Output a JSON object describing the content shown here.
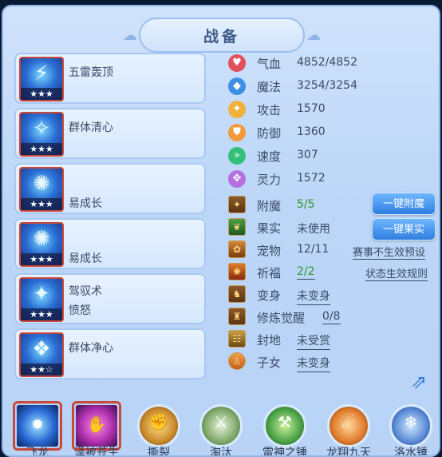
{
  "header": {
    "title": "战备"
  },
  "skills": [
    {
      "name": "五雷轰顶",
      "stars": "★★★",
      "glyph": "⚡"
    },
    {
      "name": "群体清心",
      "stars": "★★★",
      "glyph": "✧"
    },
    {
      "name": "易成长",
      "stars": "★★★",
      "glyph": "✺"
    },
    {
      "name": "易成长",
      "stars": "★★★",
      "glyph": "✺"
    },
    {
      "name": "驾驭术",
      "sub": "愤怒",
      "stars": "★★★",
      "glyph": "✦"
    },
    {
      "name": "群体净心",
      "stars": "★★☆",
      "glyph": "❖"
    }
  ],
  "stats": [
    {
      "label": "气血",
      "value": "4852/4852",
      "color": "#e2505a",
      "glyph": "♥"
    },
    {
      "label": "魔法",
      "value": "3254/3254",
      "color": "#3f8fe8",
      "glyph": "◆"
    },
    {
      "label": "攻击",
      "value": "1570",
      "color": "#f0b23a",
      "glyph": "✦"
    },
    {
      "label": "防御",
      "value": "1360",
      "color": "#f09a3a",
      "glyph": "⛊"
    },
    {
      "label": "速度",
      "value": "307",
      "color": "#33c07a",
      "glyph": "»"
    },
    {
      "label": "灵力",
      "value": "1572",
      "color": "#b56fe0",
      "glyph": "✥"
    }
  ],
  "info": {
    "fumo": {
      "label": "附魔",
      "value": "5/5"
    },
    "guoshi": {
      "label": "果实",
      "value": "未使用"
    },
    "chongwu": {
      "label": "宠物",
      "value": "12/11"
    },
    "qifu": {
      "label": "祈福",
      "value": "2/2"
    },
    "bianshen": {
      "label": "变身",
      "value": "未变身"
    },
    "xiulian": {
      "label": "修炼觉醒",
      "value": "0/8"
    },
    "fengdi": {
      "label": "封地",
      "value": "未受赏"
    },
    "zinv": {
      "label": "子女",
      "value": "未变身"
    }
  },
  "buttons": {
    "one_click_enchant": "一键附魔",
    "one_click_fruit": "一键果实"
  },
  "links": {
    "season_preset": "赛事不生效预设",
    "status_rules": "状态生效规则"
  },
  "talents": [
    {
      "name": "飞龙",
      "style": "sq",
      "bg": "radial-gradient(circle,#9fe6ff 0%,#2a6ad6 55%,#0e2258 100%)",
      "glyph": "✹"
    },
    {
      "name": "泽被苍生",
      "style": "sq",
      "bg": "radial-gradient(circle,#ff8fe0 0%,#b030b0 55%,#3a0e4a 100%)",
      "glyph": "✋"
    },
    {
      "name": "撕裂",
      "style": "circ",
      "bg": "radial-gradient(circle,#ffe08a 0%,#c9892a 60%,#5a3a14 100%)",
      "glyph": "✊"
    },
    {
      "name": "淘汰",
      "style": "circ",
      "bg": "radial-gradient(circle,#e6f2d8 0%,#7fa86a 60%,#34502a 100%)",
      "glyph": "⚔"
    },
    {
      "name": "雷神之锤",
      "style": "circ",
      "bg": "radial-gradient(circle,#c9f09a 0%,#4aa046 60%,#1e4a22 100%)",
      "glyph": "⚒"
    },
    {
      "name": "龙翔九天",
      "style": "circ",
      "bg": "radial-gradient(circle,#ffd79a 0%,#e07a2a 60%,#6a2a10 100%)",
      "glyph": "☄"
    },
    {
      "name": "洛水锤",
      "style": "circ",
      "bg": "radial-gradient(circle,#cfe8ff 0%,#5a8ad6 60%,#1a2e6a 100%)",
      "glyph": "❄"
    }
  ]
}
